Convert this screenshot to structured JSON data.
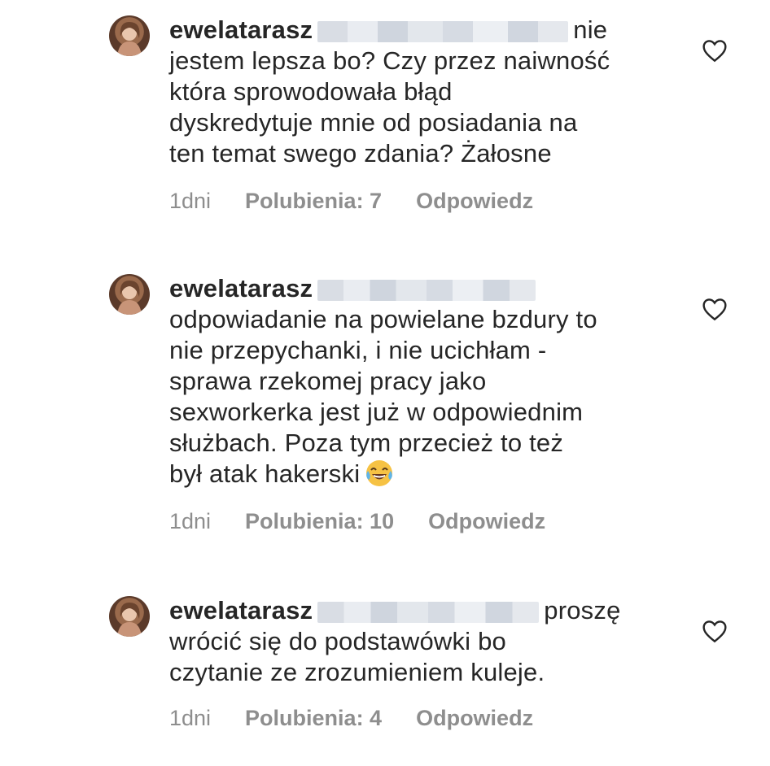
{
  "comments": [
    {
      "username": "ewelatarasz",
      "lines": [
        "nie",
        "jestem lepsza bo? Czy przez naiwność",
        "która sprowodowała błąd",
        "dyskredytuje mnie od posiadania na",
        "ten temat swego zdania? Żałosne"
      ],
      "time": "1dni",
      "likes": "Polubienia: 7",
      "reply": "Odpowiedz"
    },
    {
      "username": "ewelatarasz",
      "lines": [
        "",
        "odpowiadanie na powielane bzdury to",
        "nie przepychanki, i nie ucichłam -",
        "sprawa rzekomej pracy jako",
        "sexworkerka jest już w odpowiednim",
        "służbach. Poza tym przecież to też",
        "był atak hakerski"
      ],
      "emoji": "face-with-tears-of-joy",
      "time": "1dni",
      "likes": "Polubienia: 10",
      "reply": "Odpowiedz"
    },
    {
      "username": "ewelatarasz",
      "lines": [
        "proszę",
        "wrócić się do podstawówki bo",
        "czytanie ze zrozumieniem kuleje."
      ],
      "time": "1dni",
      "likes": "Polubienia: 4",
      "reply": "Odpowiedz"
    }
  ],
  "icons": {
    "like": "heart-outline-icon"
  },
  "colors": {
    "text": "#262626",
    "meta": "#8e8e8e",
    "redacted": "#d9dde4"
  }
}
